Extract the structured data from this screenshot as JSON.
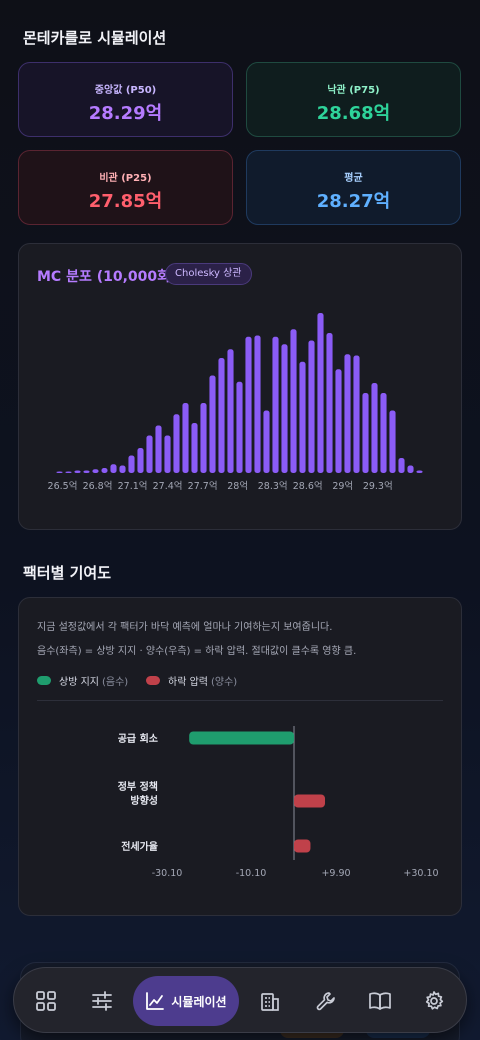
{
  "page": {
    "title": "몬테카를로 시뮬레이션",
    "contrib_title": "팩터별 기여도"
  },
  "stats": {
    "p50": {
      "label": "중앙값 (P50)",
      "value": "28.29억"
    },
    "p75": {
      "label": "낙관 (P75)",
      "value": "28.68억"
    },
    "p25": {
      "label": "비관 (P25)",
      "value": "27.85억"
    },
    "mean": {
      "label": "평균",
      "value": "28.27억"
    }
  },
  "histogram": {
    "title": "MC 분포 (10,000회)",
    "badge": "Cholesky 상관"
  },
  "chart_data": [
    {
      "type": "bar",
      "title": "MC 분포 (10,000회)",
      "x_tick_labels": [
        "26.5억",
        "26.8억",
        "27.1억",
        "27.4억",
        "27.7억",
        "28억",
        "28.3억",
        "28.6억",
        "29억",
        "29.3억"
      ],
      "xlim": [
        26.47,
        29.63
      ],
      "bin_width": 0.0625,
      "bin_start": 26.5,
      "values": [
        1,
        1,
        2,
        2,
        3,
        4,
        7,
        6,
        14,
        20,
        30,
        38,
        30,
        47,
        56,
        40,
        56,
        78,
        92,
        99,
        73,
        109,
        110,
        50,
        109,
        103,
        115,
        89,
        106,
        128,
        112,
        83,
        95,
        94,
        64,
        72,
        64,
        50,
        12,
        6,
        2
      ],
      "colors": {
        "bar": "#8b5cf6"
      },
      "grid": false
    },
    {
      "type": "bar",
      "orientation": "horizontal",
      "categories": [
        "공급 회소",
        "정부 정책 방향성",
        "전세가율"
      ],
      "values": [
        -22.3,
        6.6,
        3.5
      ],
      "x_tick_labels": [
        "-30.10",
        "-10.10",
        "+9.90",
        "+30.10"
      ],
      "xlim": [
        -30.1,
        30.1
      ],
      "series": [
        {
          "name": "상방 지지",
          "color": "#1f9d6e"
        },
        {
          "name": "하락 압력",
          "color": "#c0414a"
        }
      ]
    }
  ],
  "contrib": {
    "desc_line1": "지금 설정값에서 각 팩터가 바닥 예측에 얼마나 기여하는지 보여줍니다.",
    "desc_line2": "음수(좌측) = 상방 지지 · 양수(우측) = 하락 압력. 절대값이 클수록 영향 큼.",
    "legend_up": "상방 지지",
    "legend_up_note": "(음수)",
    "legend_down": "하락 압력",
    "legend_down_note": "(양수)",
    "colors": {
      "up": "#1f9d6e",
      "down": "#c0414a"
    }
  },
  "nav": {
    "active_label": "시뮬레이션",
    "icons": [
      "dashboard-icon",
      "sliders-icon",
      "chart-line-icon",
      "building-icon",
      "wrench-icon",
      "book-icon",
      "gear-icon"
    ]
  }
}
